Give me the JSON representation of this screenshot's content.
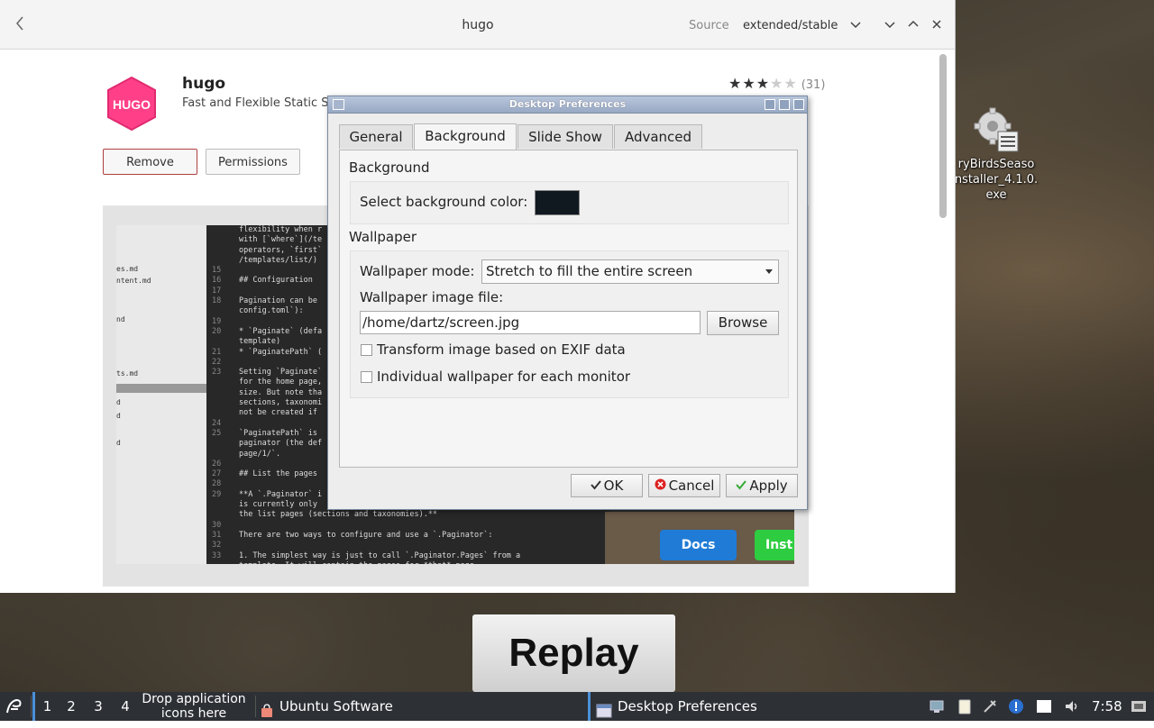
{
  "software_center": {
    "title": "hugo",
    "source_label": "Source",
    "source_value": "extended/stable",
    "app": {
      "logo_text": "HUGO",
      "name": "hugo",
      "summary": "Fast and Flexible Static S",
      "rating_stars": 3,
      "rating_max": 5,
      "rating_count": "(31)"
    },
    "buttons": {
      "remove": "Remove",
      "permissions": "Permissions"
    },
    "screenshot": {
      "docs_label": "Docs",
      "install_label": "Inst",
      "side_files": [
        "es.md",
        "ntent.md",
        "nd",
        "ts.md",
        "d",
        "d",
        "d"
      ],
      "code_lines": [
        {
          "n": "",
          "t": "flexibility when r"
        },
        {
          "n": "",
          "t": "with [`where`](/te"
        },
        {
          "n": "",
          "t": "operators, `first`"
        },
        {
          "n": "",
          "t": "/templates/list/)"
        },
        {
          "n": "15",
          "t": ""
        },
        {
          "n": "16",
          "t": "## Configuration"
        },
        {
          "n": "17",
          "t": ""
        },
        {
          "n": "18",
          "t": "Pagination can be"
        },
        {
          "n": "",
          "t": "config.toml`):"
        },
        {
          "n": "19",
          "t": ""
        },
        {
          "n": "20",
          "t": "* `Paginate` (defa"
        },
        {
          "n": "",
          "t": "template)"
        },
        {
          "n": "21",
          "t": "* `PaginatePath` ("
        },
        {
          "n": "22",
          "t": ""
        },
        {
          "n": "23",
          "t": "Setting `Paginate`"
        },
        {
          "n": "",
          "t": "for the home page,"
        },
        {
          "n": "",
          "t": "size. But note tha"
        },
        {
          "n": "",
          "t": "sections, taxonomi"
        },
        {
          "n": "",
          "t": "not be created if"
        },
        {
          "n": "24",
          "t": ""
        },
        {
          "n": "25",
          "t": "`PaginatePath` is"
        },
        {
          "n": "",
          "t": "paginator (the def"
        },
        {
          "n": "",
          "t": "page/1/`."
        },
        {
          "n": "26",
          "t": ""
        },
        {
          "n": "27",
          "t": "## List the pages"
        },
        {
          "n": "28",
          "t": ""
        },
        {
          "n": "29",
          "t": "**A `.Paginator` i"
        },
        {
          "n": "",
          "t": "is currently only"
        },
        {
          "n": "",
          "t": "the list pages (sections and taxonomies).**"
        },
        {
          "n": "30",
          "t": ""
        },
        {
          "n": "31",
          "t": "There are two ways to configure and use a `.Paginator`:"
        },
        {
          "n": "32",
          "t": ""
        },
        {
          "n": "33",
          "t": "1. The simplest way is just to call `.Paginator.Pages` from a"
        },
        {
          "n": "",
          "t": "template. It will contain the pages for *that* page."
        }
      ]
    }
  },
  "dialog": {
    "title": "Desktop Preferences",
    "tabs": [
      "General",
      "Background",
      "Slide Show",
      "Advanced"
    ],
    "active_tab": "Background",
    "background_section": "Background",
    "select_color_label": "Select background color:",
    "background_color": "#101820",
    "wallpaper_section": "Wallpaper",
    "wallpaper_mode_label": "Wallpaper mode:",
    "wallpaper_mode_value": "Stretch to fill the entire screen",
    "image_file_label": "Wallpaper image file:",
    "image_file_value": "/home/dartz/screen.jpg",
    "browse_label": "Browse",
    "exif_label": "Transform image based on EXIF data",
    "individual_label": "Individual wallpaper for each monitor",
    "exif_checked": false,
    "individual_checked": false,
    "ok_label": "OK",
    "cancel_label": "Cancel",
    "apply_label": "Apply"
  },
  "desktop": {
    "icon_label_lines": [
      "ryBirdsSeaso",
      "nstaller_4.1.0.",
      "exe"
    ],
    "replay_text": "Replay"
  },
  "taskbar": {
    "workspaces": [
      "1",
      "2",
      "3",
      "4"
    ],
    "drop_text": "Drop application icons here",
    "tasks": [
      "Ubuntu Software",
      "Desktop Preferences"
    ],
    "clock": "7:58"
  },
  "colors": {
    "accent": "#4a90d9",
    "hugo_pink": "#ff4088",
    "remove_border": "#b04040",
    "docs_blue": "#1f7bd6",
    "install_green": "#2ecc40"
  }
}
